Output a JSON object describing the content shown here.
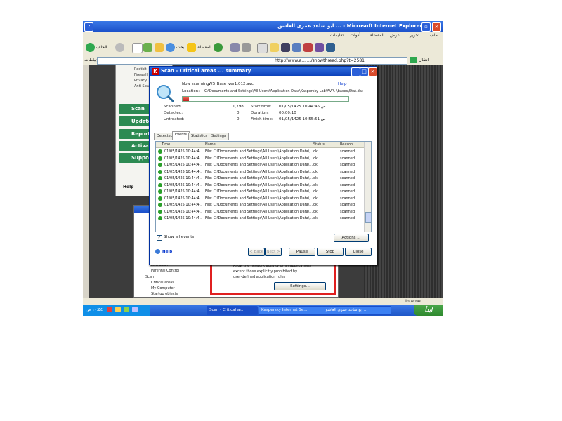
{
  "ie_window": {
    "title": "ابو ساعد عمری العاشق ... - Microsoft Internet Explorer",
    "menu": [
      "ملف",
      "تحرير",
      "عرض",
      "المفضلة",
      "أدوات",
      "تعليمات"
    ],
    "toolbar": {
      "back_label": "الخلف",
      "search_label": "بحث",
      "favorites_label": "المفضلة"
    },
    "address": {
      "url": "http://www.a... .../showthread.php?t=2581",
      "links_label": "ارتباطات",
      "go_label": "انتقال"
    },
    "status": "Internet"
  },
  "main_app": {
    "small_items": [
      "Rootkit",
      "Firewall",
      "Privacy",
      "Anti Spam"
    ],
    "side_items": [
      "Scan",
      "Update",
      "Reports",
      "Activation",
      "Support"
    ],
    "help_label": "Help"
  },
  "bg_window": {
    "tree": [
      "Anti-Spam",
      "Parental Control",
      "Scan",
      "Critical areas",
      "My Computer",
      "Startup objects"
    ],
    "description": [
      "Allow the network activity of all applications",
      "except those explicitly prohibited by",
      "user-defined application rules"
    ],
    "settings_label": "Settings..."
  },
  "scan_dialog": {
    "title": "Scan - Critical areas ... summary",
    "now_scanning_label": "Now scanning:",
    "now_scanning_value": "WS_Base_ver1.012.avc",
    "location_label": "Location:",
    "location_value": "C:\\Documents and Settings\\All Users\\Application Data\\Kaspersky Lab\\AVP...\\bases\\Stat.dat",
    "help_link": "Help",
    "progress": 0.04,
    "stats": [
      {
        "label": "Scanned:",
        "value": "1,798",
        "label2": "Start time:",
        "value2": "01/05/1425 10:44:45 ص"
      },
      {
        "label": "Detected:",
        "value": "0",
        "label2": "Duration:",
        "value2": "00:00:10"
      },
      {
        "label": "Untreated:",
        "value": "0",
        "label2": "Finish time:",
        "value2": "01/05/1425 10:55:51 ص"
      }
    ],
    "tabs": [
      "Detected",
      "Events",
      "Statistics",
      "Settings"
    ],
    "active_tab": "Events",
    "columns": [
      "Time",
      "Name",
      "Status",
      "Reason"
    ],
    "rows": [
      {
        "time": "01/05/1425 10:44:4...",
        "name": "File: C:\\Documents and Settings\\All Users\\Application Data\\...",
        "status": "ok",
        "reason": "scanned"
      },
      {
        "time": "01/05/1425 10:44:4...",
        "name": "File: C:\\Documents and Settings\\All Users\\Application Data\\...",
        "status": "ok",
        "reason": "scanned"
      },
      {
        "time": "01/05/1425 10:44:4...",
        "name": "File: C:\\Documents and Settings\\All Users\\Application Data\\...",
        "status": "ok",
        "reason": "scanned"
      },
      {
        "time": "01/05/1425 10:44:4...",
        "name": "File: C:\\Documents and Settings\\All Users\\Application Data\\...",
        "status": "ok",
        "reason": "scanned"
      },
      {
        "time": "01/05/1425 10:44:4...",
        "name": "File: C:\\Documents and Settings\\All Users\\Application Data\\...",
        "status": "ok",
        "reason": "scanned"
      },
      {
        "time": "01/05/1425 10:44:4...",
        "name": "File: C:\\Documents and Settings\\All Users\\Application Data\\...",
        "status": "ok",
        "reason": "scanned"
      },
      {
        "time": "01/05/1425 10:44:4...",
        "name": "File: C:\\Documents and Settings\\All Users\\Application Data\\...",
        "status": "ok",
        "reason": "scanned"
      },
      {
        "time": "01/05/1425 10:44:4...",
        "name": "File: C:\\Documents and Settings\\All Users\\Application Data\\...",
        "status": "ok",
        "reason": "scanned"
      },
      {
        "time": "01/05/1425 10:44:4...",
        "name": "File: C:\\Documents and Settings\\All Users\\Application Data\\...",
        "status": "ok",
        "reason": "scanned"
      },
      {
        "time": "01/05/1425 10:44:4...",
        "name": "File: C:\\Documents and Settings\\All Users\\Application Data\\...",
        "status": "ok",
        "reason": "scanned"
      },
      {
        "time": "01/05/1425 10:44:4...",
        "name": "File: C:\\Documents and Settings\\All Users\\Application Data\\...",
        "status": "ok",
        "reason": "scanned"
      }
    ],
    "show_all_events_label": "Show all events",
    "actions_label": "Actions ...",
    "help_button_label": "Help",
    "back_label": "< Back",
    "next_label": "Next >",
    "pause_label": "Pause",
    "stop_label": "Stop",
    "close_label": "Close"
  },
  "taskbar": {
    "start_label": "ابدأ",
    "tasks": [
      "ابو ساعد عمری العاشق ...",
      "Kaspersky Internet Se...",
      "Scan - Critical ar..."
    ],
    "clock": "١٠:٥٤ ص"
  },
  "colors": {
    "xp_blue": "#1a4fc9",
    "kaspersky_green": "#2c8a52",
    "start_green": "#2f8a2f",
    "ok_green": "#2aa02a",
    "progress_red": "#c02020"
  }
}
